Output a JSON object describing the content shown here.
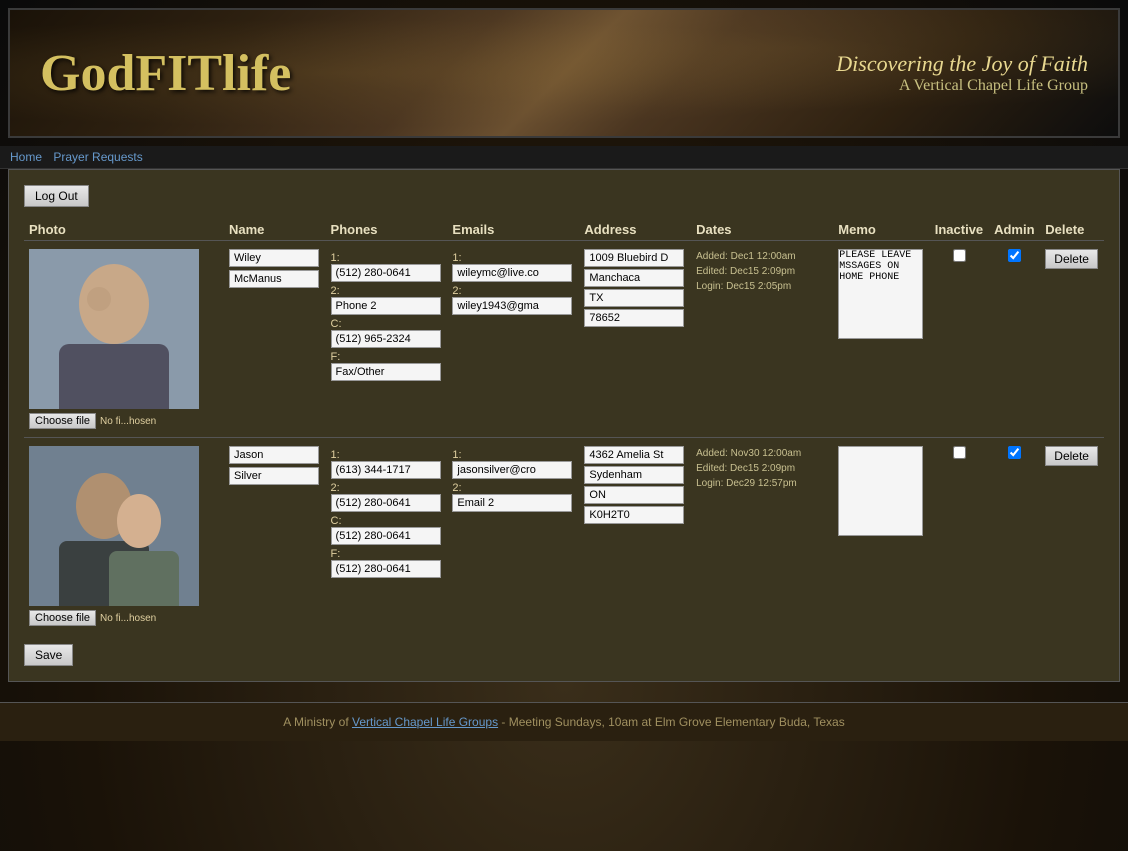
{
  "header": {
    "title": "GodFITlife",
    "tagline": "Discovering the Joy of Faith",
    "group_name": "A Vertical Chapel Life Group"
  },
  "nav": {
    "home_label": "Home",
    "prayer_requests_label": "Prayer Requests"
  },
  "toolbar": {
    "logout_label": "Log Out"
  },
  "table": {
    "columns": {
      "photo": "Photo",
      "name": "Name",
      "phones": "Phones",
      "emails": "Emails",
      "address": "Address",
      "dates": "Dates",
      "memo": "Memo",
      "inactive": "Inactive",
      "admin": "Admin",
      "delete": "Delete"
    },
    "contacts": [
      {
        "id": 1,
        "first_name": "Wiley",
        "last_name": "McManus",
        "phone_1_label": "1:",
        "phone_1": "(512) 280-0641",
        "phone_2_label": "2:",
        "phone_2": "Phone 2",
        "phone_c_label": "C:",
        "phone_c": "(512) 965-2324",
        "phone_f_label": "F:",
        "phone_f": "Fax/Other",
        "email_1_label": "1:",
        "email_1": "wileymc@live.co",
        "email_2_label": "2:",
        "email_2": "wiley1943@gma",
        "addr_1": "1009 Bluebird D",
        "addr_2": "Manchaca",
        "addr_3": "TX",
        "addr_4": "78652",
        "date_added": "Added: Dec1 12:00am",
        "date_edited": "Edited: Dec15 2:09pm",
        "date_login": "Login: Dec15 2:05pm",
        "memo": "PLEASE LEAVE MSSAGES ON HOME PHONE",
        "inactive": false,
        "admin": true,
        "delete_label": "Delete",
        "file_btn": "Choose file",
        "file_text": "No fi...hosen"
      },
      {
        "id": 2,
        "first_name": "Jason",
        "last_name": "Silver",
        "phone_1_label": "1:",
        "phone_1": "(613) 344-1717",
        "phone_2_label": "2:",
        "phone_2": "(512) 280-0641",
        "phone_c_label": "C:",
        "phone_c": "(512) 280-0641",
        "phone_f_label": "F:",
        "phone_f": "(512) 280-0641",
        "email_1_label": "1:",
        "email_1": "jasonsilver@cro",
        "email_2_label": "2:",
        "email_2": "Email 2",
        "addr_1": "4362 Amelia St",
        "addr_2": "Sydenham",
        "addr_3": "ON",
        "addr_4": "K0H2T0",
        "date_added": "Added: Nov30 12:00am",
        "date_edited": "Edited: Dec15 2:09pm",
        "date_login": "Login: Dec29 12:57pm",
        "memo": "",
        "inactive": false,
        "admin": true,
        "delete_label": "Delete",
        "file_btn": "Choose file",
        "file_text": "No fi...hosen"
      }
    ]
  },
  "save_label": "Save",
  "footer": {
    "text_before": "A Ministry of ",
    "link_text": "Vertical Chapel Life Groups",
    "text_after": " - Meeting Sundays, 10am at Elm Grove Elementary Buda, Texas"
  }
}
